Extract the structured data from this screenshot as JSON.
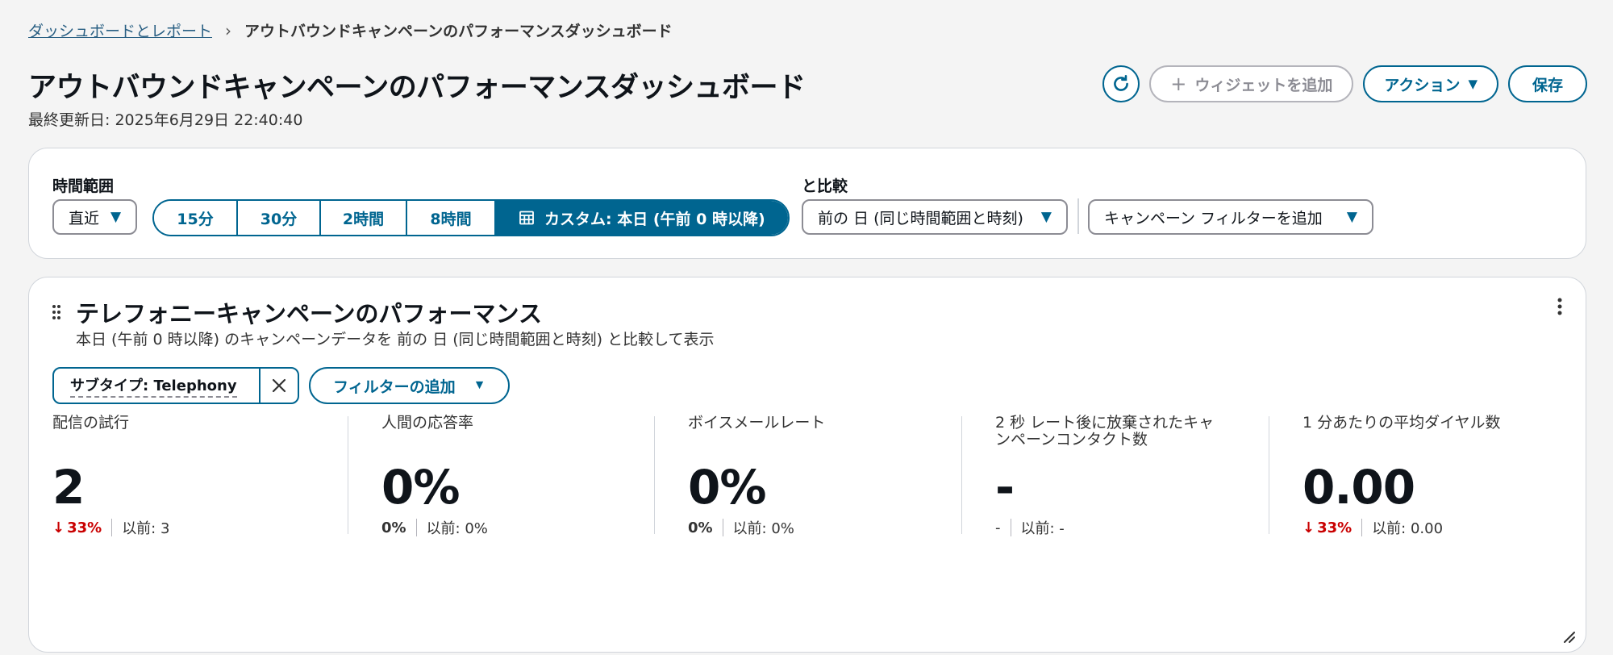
{
  "breadcrumb": {
    "parent": "ダッシュボードとレポート",
    "separator": "›",
    "current": "アウトバウンドキャンペーンのパフォーマンスダッシュボード"
  },
  "page": {
    "title": "アウトバウンドキャンペーンのパフォーマンスダッシュボード",
    "last_updated": "最終更新日: 2025年6月29日 22:40:40"
  },
  "header_actions": {
    "add_widget": "ウィジェットを追加",
    "actions": "アクション",
    "save": "保存"
  },
  "filters": {
    "time_range_label": "時間範囲",
    "recent_select": "直近",
    "segments": [
      "15分",
      "30分",
      "2時間",
      "8時間"
    ],
    "custom_segment": "カスタム: 本日 (午前 0 時以降)",
    "compare_label": "と比較",
    "compare_select": "前の 日 (同じ時間範囲と時刻)",
    "campaign_filter": "キャンペーン フィルターを追加"
  },
  "widget": {
    "title": "テレフォニーキャンペーンのパフォーマンス",
    "description": "本日 (午前 0 時以降) のキャンペーンデータを 前の 日 (同じ時間範囲と時刻) と比較して表示",
    "token_label": "サブタイプ: Telephony",
    "add_filter": "フィルターの追加",
    "metrics": [
      {
        "label": "配信の試行",
        "value": "2",
        "delta": "33%",
        "direction": "down",
        "previous": "以前: 3"
      },
      {
        "label": "人間の応答率",
        "value": "0%",
        "delta": "0%",
        "direction": "none",
        "previous": "以前: 0%"
      },
      {
        "label": "ボイスメールレート",
        "value": "0%",
        "delta": "0%",
        "direction": "none",
        "previous": "以前: 0%"
      },
      {
        "label": "2 秒 レート後に放棄されたキャンペーンコンタクト数",
        "value": "-",
        "delta": "-",
        "direction": "none",
        "previous": "以前: -"
      },
      {
        "label": "1 分あたりの平均ダイヤル数",
        "value": "0.00",
        "delta": "33%",
        "direction": "down",
        "previous": "以前: 0.00"
      }
    ]
  },
  "colors": {
    "accent": "#006590",
    "link": "#295f83",
    "negative": "#c90000",
    "border": "#d1d5db"
  }
}
